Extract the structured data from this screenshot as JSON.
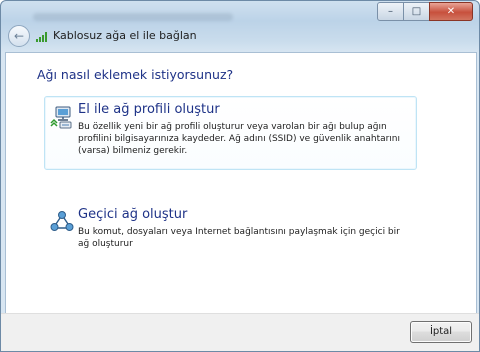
{
  "window": {
    "buttons": {
      "minimize": "–",
      "maximize": "□",
      "close": "✕"
    }
  },
  "nav": {
    "back_symbol": "←",
    "title": "Kablosuz ağa el ile bağlan",
    "icon": "wifi-signal-icon"
  },
  "main": {
    "question": "Ağı nasıl eklemek istiyorsunuz?",
    "options": [
      {
        "title": "El ile ağ profili oluştur",
        "description": "Bu özellik yeni bir ağ profili oluşturur veya varolan bir ağı bulup ağın profilini bilgisayarınıza kaydeder. Ağ adını (SSID) ve güvenlik anahtarını (varsa) bilmeniz gerekir.",
        "icon": "wireless-computer-icon",
        "selected": true
      },
      {
        "title": "Geçici ağ oluştur",
        "description": "Bu komut, dosyaları veya Internet bağlantısını paylaşmak için geçici bir ağ oluşturur",
        "icon": "ad-hoc-network-icon",
        "selected": false
      }
    ]
  },
  "footer": {
    "cancel_label": "İptal"
  },
  "colors": {
    "accent_text": "#1e3287",
    "selection_border": "#bfe4f5",
    "close_button": "#c7503d"
  }
}
